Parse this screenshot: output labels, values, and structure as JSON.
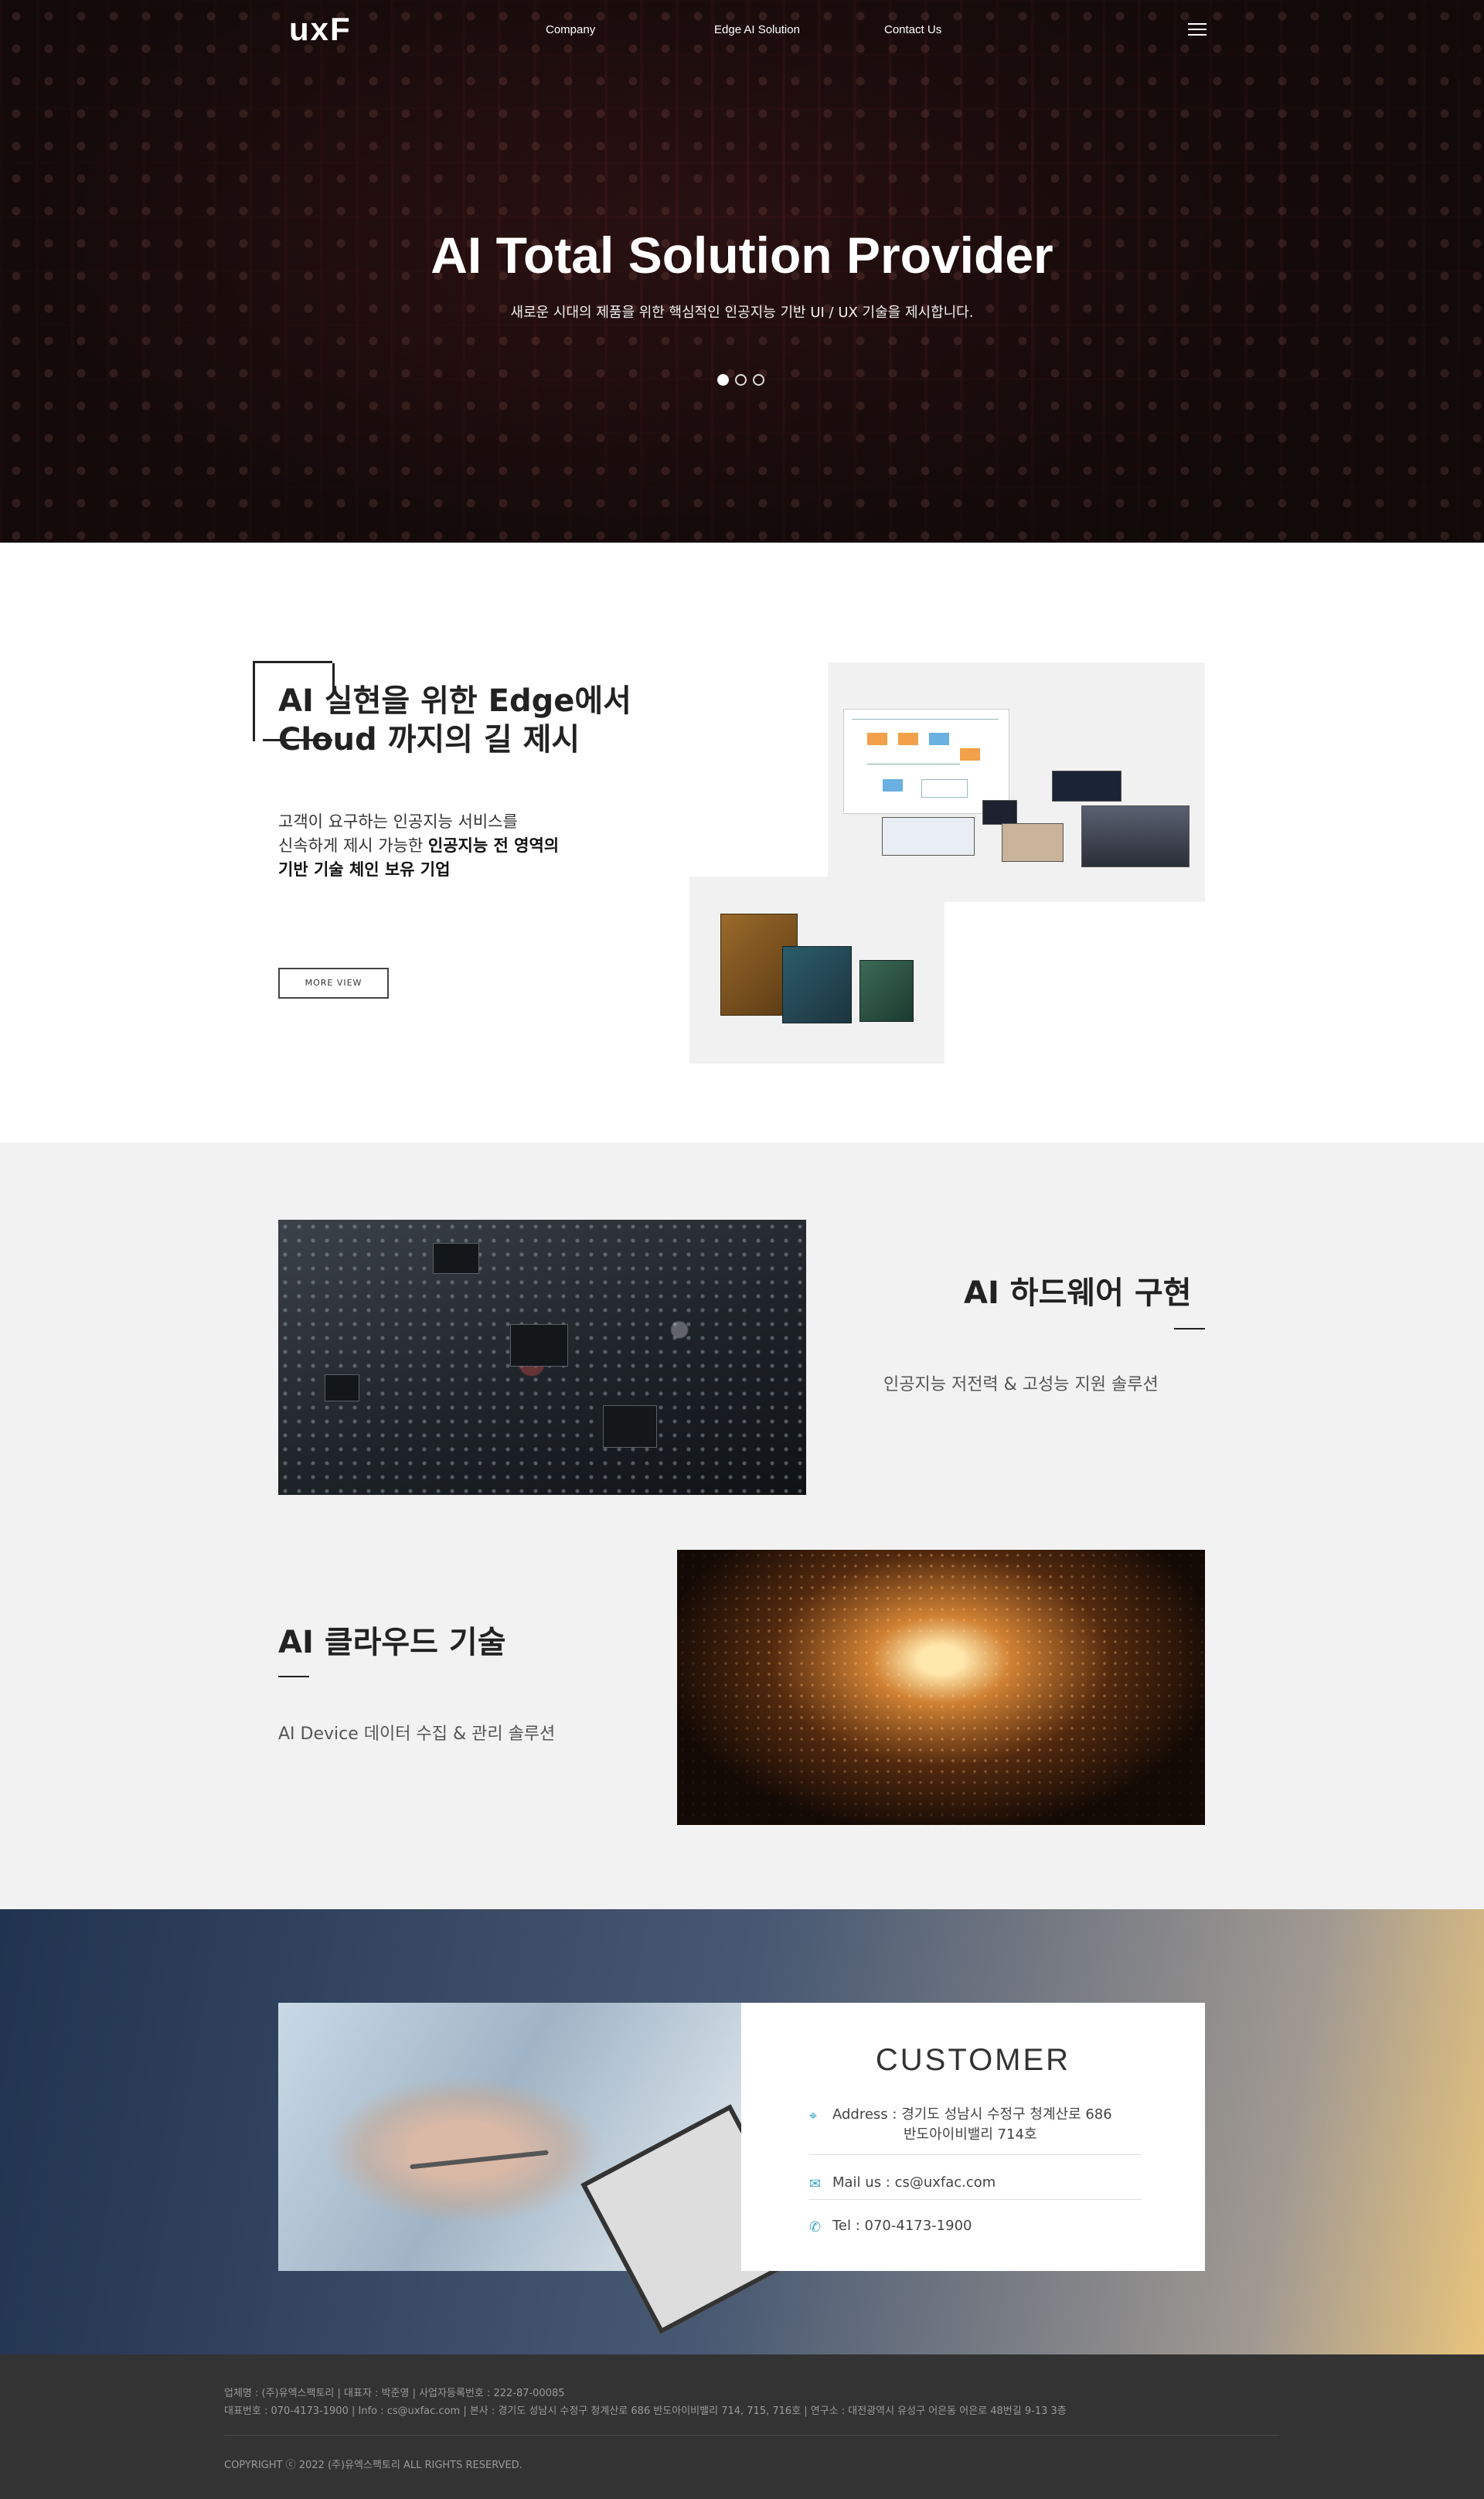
{
  "nav": {
    "logo": "uxF",
    "links": [
      "Company",
      "Edge AI Solution",
      "Contact Us"
    ]
  },
  "hero": {
    "title": "AI Total Solution Provider",
    "subtitle": "새로운 시대의 제품을 위한 핵심적인 인공지능 기반 UI / UX 기술을 제시합니다.",
    "slide_count": 3,
    "active_slide": 1
  },
  "edge": {
    "title_line1": "AI 실현을 위한 Edge에서",
    "title_line2": "Cloud 까지의 길 제시",
    "desc_line1": "고객이 요구하는 인공지능 서비스를",
    "desc_line2_plain": "신속하게 제시 가능한 ",
    "desc_line2_bold": "인공지능 전 영역의",
    "desc_line3_bold": "기반 기술 체인 보유 기업",
    "more_label": "MORE VIEW"
  },
  "hardware": {
    "title": "AI 하드웨어 구현",
    "desc": "인공지능 저전력 & 고성능 지원 솔루션"
  },
  "cloud": {
    "title": "AI 클라우드 기술",
    "desc": "AI Device 데이터 수집 & 관리 솔루션"
  },
  "customer": {
    "title": "CUSTOMER",
    "address_line1": "Address : 경기도 성남시 수정구 청계산로 686",
    "address_line2": "반도아이비밸리 714호",
    "mail": "Mail us : cs@uxfac.com",
    "tel": "Tel : 070-4173-1900",
    "icons": [
      "location-pin-icon",
      "mail-icon",
      "phone-icon"
    ],
    "accent": "#3aa6c9"
  },
  "footer": {
    "line1": "업체명 : (주)유엑스팩토리  |  대표자 : 박준영   |   사업자등록번호 : 222-87-00085",
    "line2": "대표번호 : 070-4173-1900   |   Info : cs@uxfac.com   |   본사 : 경기도 성남시 수정구 청계산로 686 반도아이비밸리 714, 715, 716호  |  연구소 : 대전광역시 유성구 어은동 어은로 48번길 9-13 3층",
    "copyright": "COPYRIGHT ⓒ 2022 (주)유엑스팩토리 ALL RIGHTS RESERVED."
  }
}
